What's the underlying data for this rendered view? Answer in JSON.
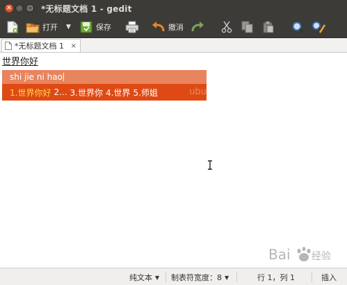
{
  "window": {
    "title": "*无标题文档 1 - gedit"
  },
  "toolbar": {
    "open_label": "打开",
    "save_label": "保存",
    "undo_label": "撤消"
  },
  "tab": {
    "label": "*无标题文档 1",
    "close": "×"
  },
  "editor": {
    "text": "世界你好"
  },
  "ime": {
    "preedit": "shi jie ni hao",
    "candidates": [
      "1.世界你好",
      "2...",
      "3.世界你",
      "4.世界",
      "5.师姐"
    ],
    "selected_index": 0,
    "watermark": "ubu"
  },
  "status": {
    "lang": "纯文本",
    "tab_width": "制表符宽度：8",
    "position": "行 1，列 1",
    "mode": "插入"
  },
  "colors": {
    "titlebar": "#3c3b37",
    "close_button": "#e8592a",
    "ime_preedit": "#e8845e",
    "ime_candidates": "#df4a14",
    "selected_candidate": "#ffd84a"
  }
}
